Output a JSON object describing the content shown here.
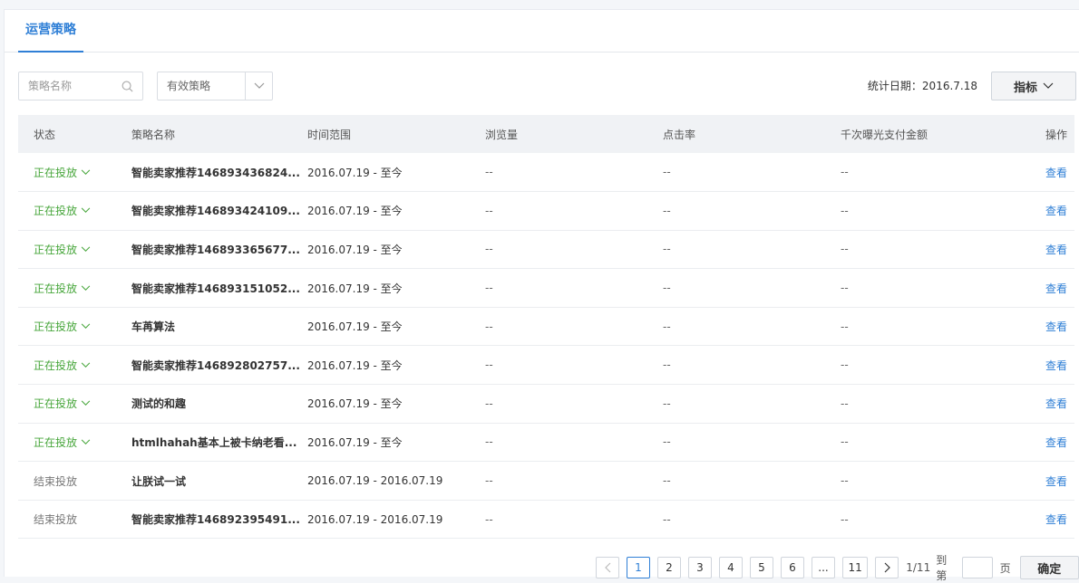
{
  "tab": {
    "label": "运营策略"
  },
  "toolbar": {
    "search_placeholder": "策略名称",
    "select_value": "有效策略",
    "stat_label": "统计日期：2016.7.18",
    "metric_label": "指标"
  },
  "table": {
    "headers": [
      "状态",
      "策略名称",
      "时间范围",
      "浏览量",
      "点击率",
      "千次曝光支付金额",
      "操作"
    ],
    "rows": [
      {
        "status": "正在投放",
        "active": true,
        "name": "智能卖家推荐146893436824...",
        "range": "2016.07.19 - 至今",
        "views": "--",
        "ctr": "--",
        "rpm": "--",
        "op": "查看"
      },
      {
        "status": "正在投放",
        "active": true,
        "name": "智能卖家推荐146893424109...",
        "range": "2016.07.19 - 至今",
        "views": "--",
        "ctr": "--",
        "rpm": "--",
        "op": "查看"
      },
      {
        "status": "正在投放",
        "active": true,
        "name": "智能卖家推荐146893365677...",
        "range": "2016.07.19 - 至今",
        "views": "--",
        "ctr": "--",
        "rpm": "--",
        "op": "查看"
      },
      {
        "status": "正在投放",
        "active": true,
        "name": "智能卖家推荐146893151052...",
        "range": "2016.07.19 - 至今",
        "views": "--",
        "ctr": "--",
        "rpm": "--",
        "op": "查看"
      },
      {
        "status": "正在投放",
        "active": true,
        "name": "车苒算法",
        "range": "2016.07.19 - 至今",
        "views": "--",
        "ctr": "--",
        "rpm": "--",
        "op": "查看"
      },
      {
        "status": "正在投放",
        "active": true,
        "name": "智能卖家推荐146892802757...",
        "range": "2016.07.19 - 至今",
        "views": "--",
        "ctr": "--",
        "rpm": "--",
        "op": "查看"
      },
      {
        "status": "正在投放",
        "active": true,
        "name": "测试的和趣",
        "range": "2016.07.19 - 至今",
        "views": "--",
        "ctr": "--",
        "rpm": "--",
        "op": "查看"
      },
      {
        "status": "正在投放",
        "active": true,
        "name": "htmlhahah基本上被卡纳老看...",
        "range": "2016.07.19 - 至今",
        "views": "--",
        "ctr": "--",
        "rpm": "--",
        "op": "查看"
      },
      {
        "status": "结束投放",
        "active": false,
        "name": "让朕试一试",
        "range": "2016.07.19 - 2016.07.19",
        "views": "--",
        "ctr": "--",
        "rpm": "--",
        "op": "查看"
      },
      {
        "status": "结束投放",
        "active": false,
        "name": "智能卖家推荐146892395491...",
        "range": "2016.07.19 - 2016.07.19",
        "views": "--",
        "ctr": "--",
        "rpm": "--",
        "op": "查看"
      }
    ]
  },
  "pager": {
    "pages": [
      "1",
      "2",
      "3",
      "4",
      "5",
      "6",
      "...",
      "11"
    ],
    "summary": "1/11",
    "goto_label": "到第",
    "page_unit": "页",
    "confirm": "确定"
  },
  "colors": {
    "accent": "#2f7fd6",
    "active_status": "#47a63b"
  },
  "icons": {
    "search": "search-icon",
    "dropdown": "chevron-down-icon",
    "prev": "chevron-left-icon",
    "next": "chevron-right-icon"
  }
}
